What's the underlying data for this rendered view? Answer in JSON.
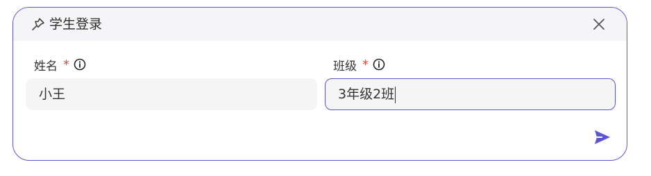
{
  "dialog": {
    "title": "学生登录",
    "title_icon": "pin-icon",
    "close_icon": "close-icon"
  },
  "fields": [
    {
      "label": "姓名",
      "required_mark": "*",
      "info_icon": "info-icon",
      "value": "小王"
    },
    {
      "label": "班级",
      "required_mark": "*",
      "info_icon": "info-icon",
      "value": "3年级2班"
    }
  ],
  "actions": {
    "send_icon": "send-icon"
  },
  "colors": {
    "accent": "#5b55d6",
    "required": "#e0463a",
    "input_bg": "#f5f5f5",
    "header_bg": "#f5f5f7"
  }
}
